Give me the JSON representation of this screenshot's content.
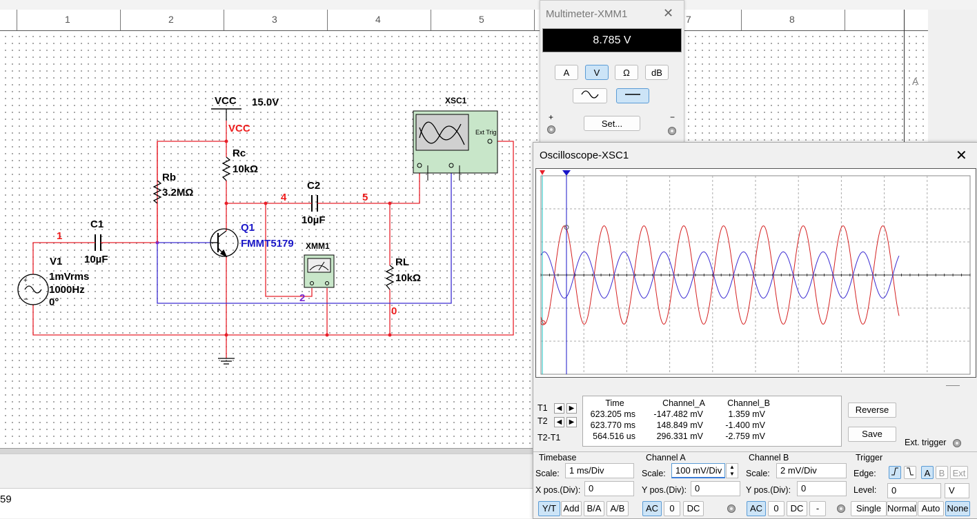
{
  "ruler": {
    "columns": [
      "1",
      "2",
      "3",
      "4",
      "5",
      "6",
      "7",
      "8"
    ],
    "row_label": "A"
  },
  "schematic": {
    "vcc_label": "VCC",
    "vcc_value": "15.0V",
    "vcc_net": "VCC",
    "rc_name": "Rc",
    "rc_value": "10kΩ",
    "rb_name": "Rb",
    "rb_value": "3.2MΩ",
    "c1_name": "C1",
    "c1_value": "10µF",
    "c2_name": "C2",
    "c2_value": "10µF",
    "q1_name": "Q1",
    "q1_model": "FMMT5179",
    "v1_name": "V1",
    "v1_amp": "1mVrms",
    "v1_freq": "1000Hz",
    "v1_phase": "0°",
    "rl_name": "RL",
    "rl_value": "10kΩ",
    "xmm_name": "XMM1",
    "xsc_name": "XSC1",
    "xsc_ext": "Ext Trig",
    "net_1": "1",
    "net_2": "2",
    "net_4": "4",
    "net_5": "5",
    "net_0": "0",
    "colors": {
      "wire_red": "#e8202a",
      "wire_blue": "#3a2bd1",
      "label_red": "#ee1c1c",
      "label_blue": "#1a16c8",
      "net_purple": "#7a2bd1"
    }
  },
  "status": {
    "bottom_number": "59"
  },
  "multimeter": {
    "title": "Multimeter-XMM1",
    "reading": "8.785 V",
    "modes": [
      "A",
      "V",
      "Ω",
      "dB"
    ],
    "active_mode": "V",
    "ac_icon": "sine-wave-icon",
    "dc_icon": "dc-line-icon",
    "set_label": "Set...",
    "plus": "+",
    "minus": "−"
  },
  "oscilloscope": {
    "title": "Oscilloscope-XSC1",
    "t1_label": "T1",
    "t2_label": "T2",
    "t2t1_label": "T2-T1",
    "table_headers": [
      "Time",
      "Channel_A",
      "Channel_B"
    ],
    "rows": [
      {
        "time": "623.205 ms",
        "a": "-147.482 mV",
        "b": "1.359 mV"
      },
      {
        "time": "623.770 ms",
        "a": "148.849 mV",
        "b": "-1.400 mV"
      },
      {
        "time": "564.516 us",
        "a": "296.331 mV",
        "b": "-2.759 mV"
      }
    ],
    "reverse_label": "Reverse",
    "save_label": "Save",
    "ext_trigger_label": "Ext. trigger",
    "timebase": {
      "title": "Timebase",
      "scale_label": "Scale:",
      "scale": "1 ms/Div",
      "xpos_label": "X pos.(Div):",
      "xpos": "0",
      "buttons": [
        "Y/T",
        "Add",
        "B/A",
        "A/B"
      ],
      "active": "Y/T"
    },
    "channel_a": {
      "title": "Channel A",
      "scale_label": "Scale:",
      "scale": "100 mV/Div",
      "ypos_label": "Y pos.(Div):",
      "ypos": "0",
      "buttons": [
        "AC",
        "0",
        "DC"
      ],
      "active": "AC"
    },
    "channel_b": {
      "title": "Channel B",
      "scale_label": "Scale:",
      "scale": "2 mV/Div",
      "ypos_label": "Y pos.(Div):",
      "ypos": "0",
      "buttons": [
        "AC",
        "0",
        "DC",
        "-"
      ],
      "active": "AC"
    },
    "trigger": {
      "title": "Trigger",
      "edge_label": "Edge:",
      "sources": [
        "A",
        "B",
        "Ext"
      ],
      "active_source": "A",
      "level_label": "Level:",
      "level": "0",
      "level_unit": "V",
      "modes": [
        "Single",
        "Normal",
        "Auto",
        "None"
      ],
      "active_mode": "None"
    },
    "trace": {
      "channel_a_color": "#d42020",
      "channel_b_color": "#3a2bd1",
      "channel_a_peak_mV": 148.8,
      "channel_b_peak_mV": 1.4,
      "frequency_Hz": 1000,
      "cycles_shown": 9
    }
  }
}
